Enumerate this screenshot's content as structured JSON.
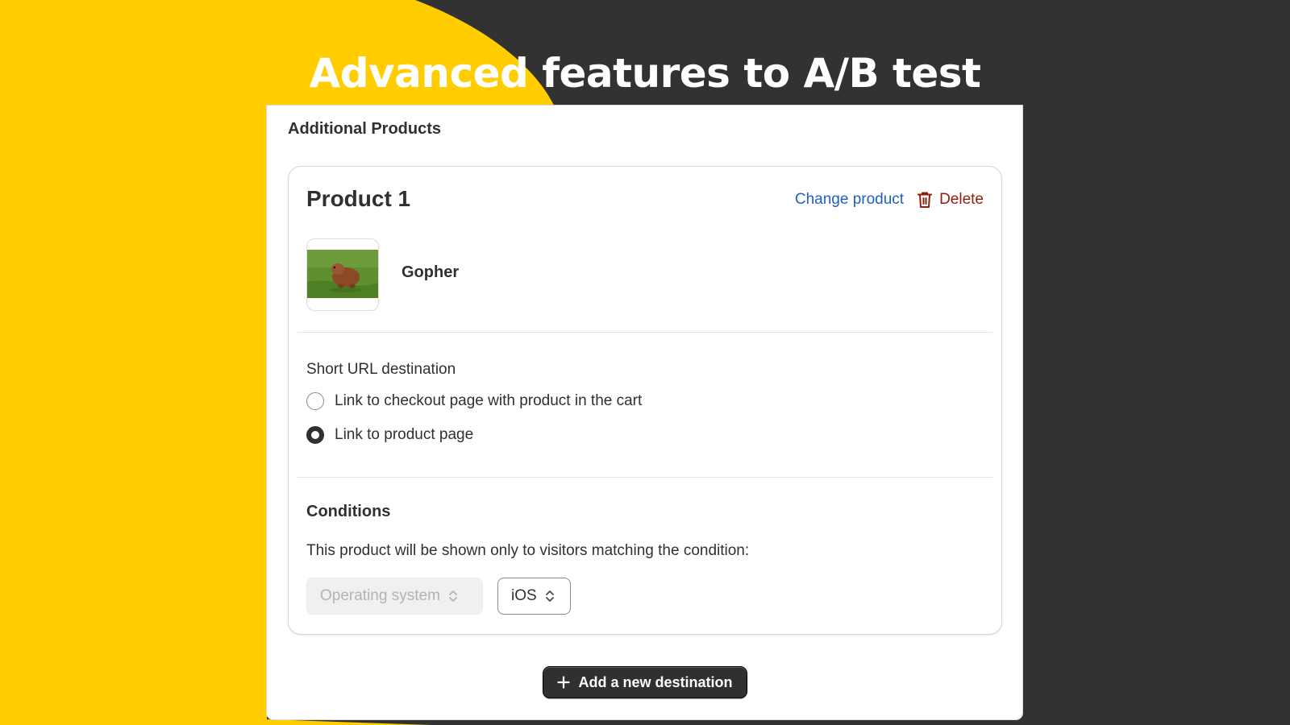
{
  "banner": {
    "headline": "Advanced features to A/B test",
    "colors": {
      "yellow": "#FFCD00",
      "dark": "#333233"
    }
  },
  "panel": {
    "section_title": "Additional Products",
    "product_card": {
      "title": "Product 1",
      "change_link": "Change product",
      "delete_label": "Delete",
      "delete_icon": "trash-icon",
      "product": {
        "name": "Gopher",
        "thumbnail": "gopher-photo"
      },
      "short_url": {
        "label": "Short URL destination",
        "options": [
          {
            "label": "Link to checkout page with product in the cart",
            "selected": false
          },
          {
            "label": "Link to product page",
            "selected": true
          }
        ]
      },
      "conditions": {
        "title": "Conditions",
        "description": "This product will be shown only to visitors matching the condition:",
        "field_select": {
          "value": "Operating system",
          "disabled": true,
          "icon": "select-chevron-icon"
        },
        "value_select": {
          "value": "iOS",
          "disabled": false,
          "icon": "select-chevron-icon"
        }
      }
    },
    "add_button": {
      "label": "Add a new destination",
      "icon": "plus-icon"
    },
    "colors": {
      "link": "#1f5fc4",
      "danger": "#8e1f0b",
      "primary_button": "#303030"
    }
  }
}
